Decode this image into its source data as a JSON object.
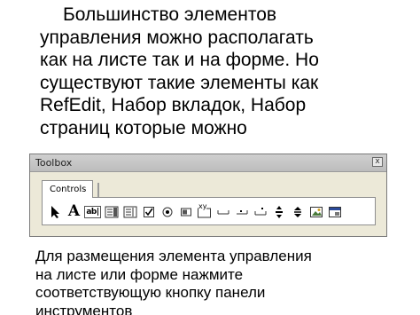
{
  "slide": {
    "upper_lines": [
      "Большинство элементов",
      "управления можно располагать",
      "как на листе так и на форме. Но",
      "существуют такие элементы как",
      "RefEdit, Набор вкладок, Набор",
      "страниц которые можно"
    ],
    "lower_lines": [
      "Для размещения элемента управления",
      "на листе или форме нажмите",
      "соответствующую кнопку панели",
      "инструментов"
    ]
  },
  "toolbox": {
    "title": "Toolbox",
    "close_glyph": "x",
    "tab_label": "Controls",
    "tools": [
      {
        "icon": "select-objects-icon"
      },
      {
        "icon": "label-icon",
        "glyph": "A"
      },
      {
        "icon": "textbox-icon",
        "glyph": "ab|"
      },
      {
        "icon": "combobox-icon"
      },
      {
        "icon": "listbox-icon"
      },
      {
        "icon": "checkbox-icon"
      },
      {
        "icon": "option-button-icon"
      },
      {
        "icon": "toggle-button-icon"
      },
      {
        "icon": "frame-icon",
        "glyph": "xy"
      },
      {
        "icon": "command-button-icon"
      },
      {
        "icon": "tabstrip-icon"
      },
      {
        "icon": "multipage-icon"
      },
      {
        "icon": "scrollbar-icon"
      },
      {
        "icon": "spin-button-icon"
      },
      {
        "icon": "image-icon"
      },
      {
        "icon": "refedit-icon"
      }
    ]
  }
}
